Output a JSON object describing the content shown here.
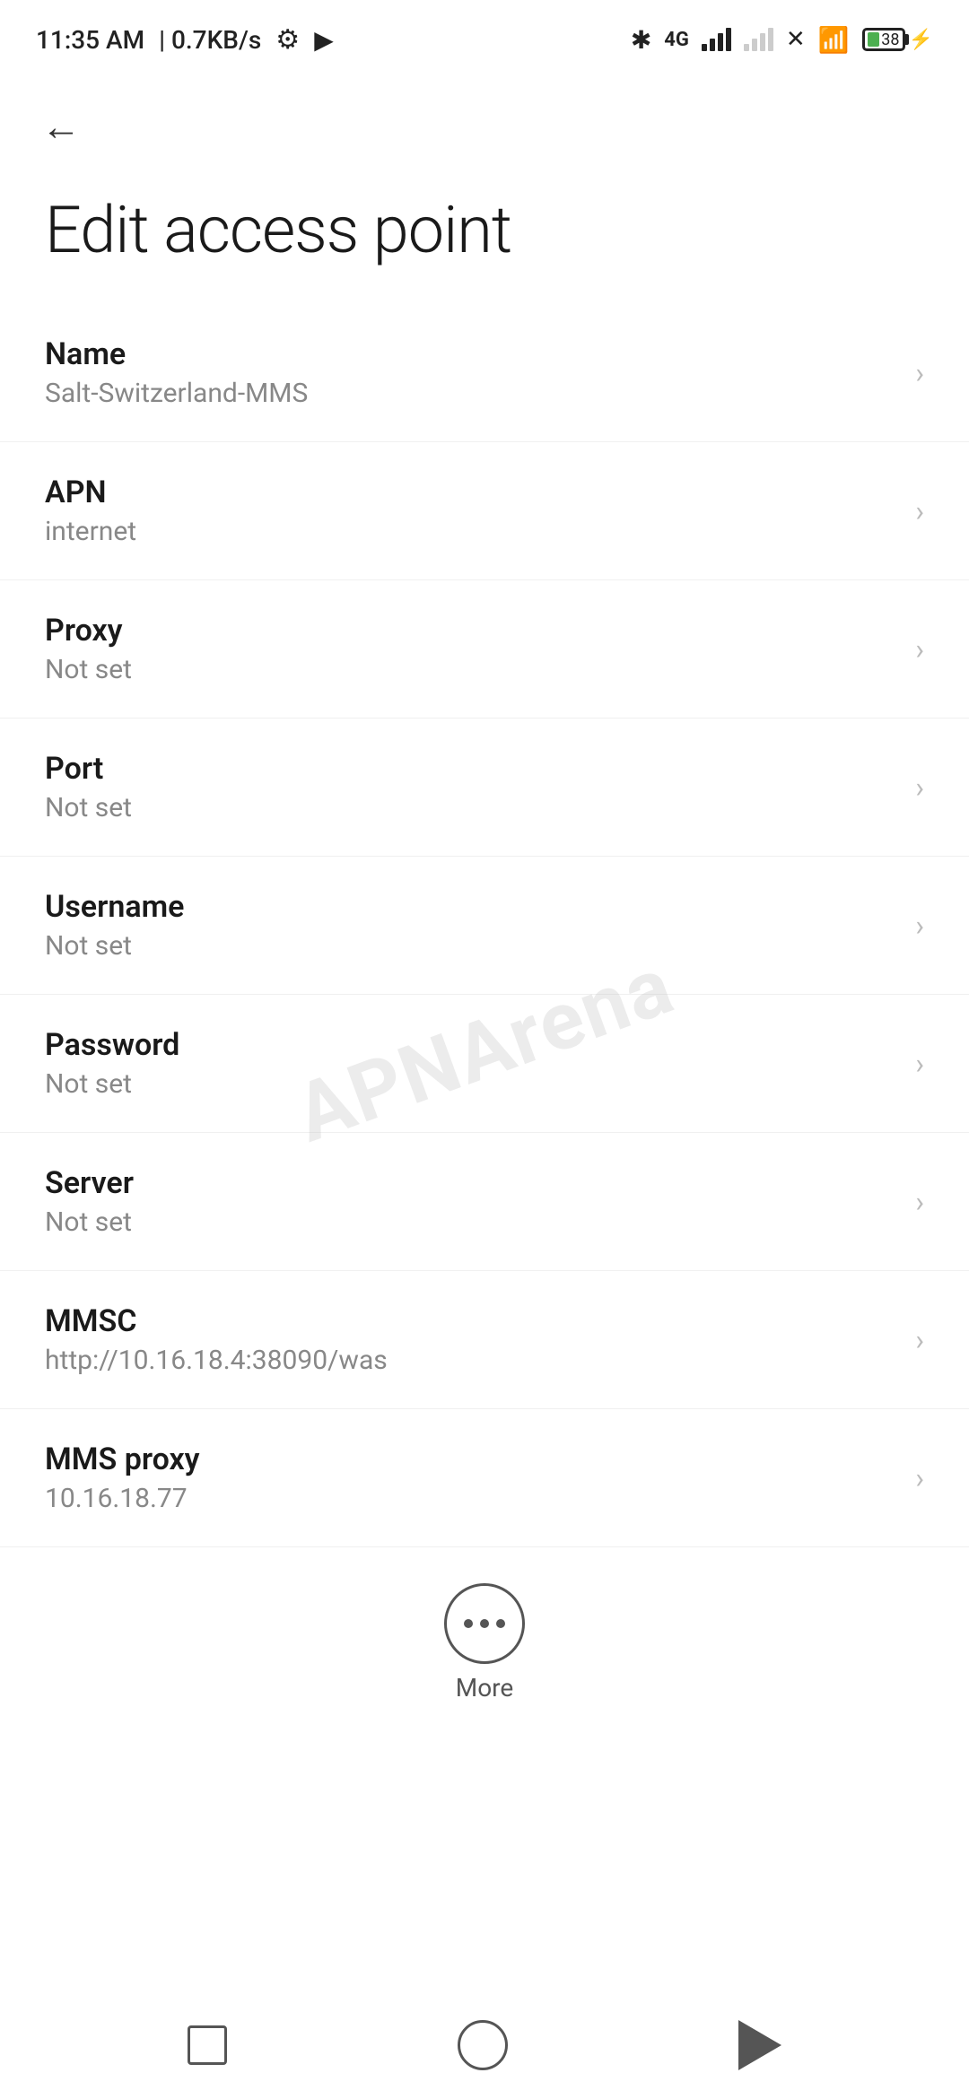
{
  "statusBar": {
    "time": "11:35 AM",
    "speed": "0.7KB/s",
    "battery": "38"
  },
  "page": {
    "title": "Edit access point"
  },
  "settings": [
    {
      "label": "Name",
      "value": "Salt-Switzerland-MMS"
    },
    {
      "label": "APN",
      "value": "internet"
    },
    {
      "label": "Proxy",
      "value": "Not set"
    },
    {
      "label": "Port",
      "value": "Not set"
    },
    {
      "label": "Username",
      "value": "Not set"
    },
    {
      "label": "Password",
      "value": "Not set"
    },
    {
      "label": "Server",
      "value": "Not set"
    },
    {
      "label": "MMSC",
      "value": "http://10.16.18.4:38090/was"
    },
    {
      "label": "MMS proxy",
      "value": "10.16.18.77"
    }
  ],
  "more": {
    "label": "More"
  },
  "watermark": "APNArena"
}
